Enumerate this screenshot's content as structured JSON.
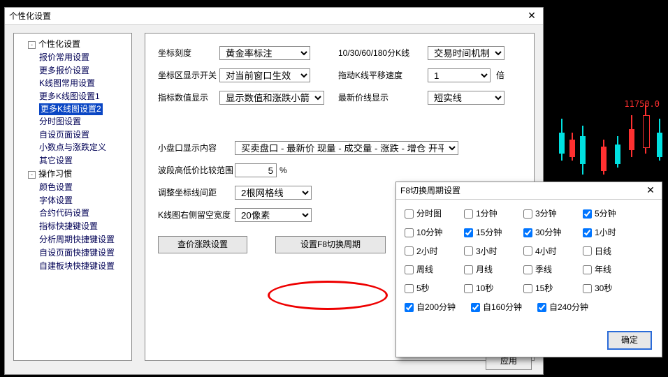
{
  "main": {
    "title": "个性化设置",
    "tree": {
      "root1": "个性化设置",
      "items1": [
        "报价常用设置",
        "更多报价设置",
        "K线图常用设置",
        "更多K线图设置1",
        "更多K线图设置2",
        "分时图设置",
        "自设页面设置",
        "小数点与涨跌定义",
        "其它设置"
      ],
      "selIndex": 4,
      "root2": "操作习惯",
      "items2": [
        "颜色设置",
        "字体设置",
        "合约代码设置",
        "指标快捷键设置",
        "分析周期快捷键设置",
        "自设页面快捷键设置",
        "自建板块快捷键设置"
      ]
    },
    "labels": {
      "zbkd": "坐标刻度",
      "zbqxkkg": "坐标区显示开关",
      "zbszxs": "指标数值显示",
      "r_1030": "10/30/60/180分K线",
      "r_drag": "拖动K线平移速度",
      "r_last": "最新价线显示",
      "bei": "倍",
      "xpkxs": "小盘口显示内容",
      "bdgd": "波段高低价比较范围",
      "tzzb": "调整坐标线间距",
      "kxylk": "K线图右侧留空宽度",
      "pct": "%"
    },
    "values": {
      "zbkd": "黄金率标注",
      "zbqxkkg": "对当前窗口生效",
      "zbszxs": "显示数值和涨跌小箭头",
      "r_1030": "交易时间机制",
      "r_drag": "1",
      "r_last": "短实线",
      "xpkxs": "买卖盘口 - 最新价 现量 - 成交量 - 涨跌 - 增仓 开平",
      "bdgd": "5",
      "tzzb": "2根网格线",
      "kxylk": "20像素"
    },
    "buttons": {
      "cjzd": "查价涨跌设置",
      "szf8": "设置F8切换周期",
      "apply": "应用"
    }
  },
  "pop": {
    "title": "F8切换周期设置",
    "rows": [
      [
        {
          "l": "分时图",
          "c": 0
        },
        {
          "l": "1分钟",
          "c": 0
        },
        {
          "l": "3分钟",
          "c": 0
        },
        {
          "l": "5分钟",
          "c": 1
        }
      ],
      [
        {
          "l": "10分钟",
          "c": 0
        },
        {
          "l": "15分钟",
          "c": 1
        },
        {
          "l": "30分钟",
          "c": 1
        },
        {
          "l": "1小时",
          "c": 1
        }
      ],
      [
        {
          "l": "2小时",
          "c": 0
        },
        {
          "l": "3小时",
          "c": 0
        },
        {
          "l": "4小时",
          "c": 0
        },
        {
          "l": "日线",
          "c": 0
        }
      ],
      [
        {
          "l": "周线",
          "c": 0
        },
        {
          "l": "月线",
          "c": 0
        },
        {
          "l": "季线",
          "c": 0
        },
        {
          "l": "年线",
          "c": 0
        }
      ],
      [
        {
          "l": "5秒",
          "c": 0
        },
        {
          "l": "10秒",
          "c": 0
        },
        {
          "l": "15秒",
          "c": 0
        },
        {
          "l": "30秒",
          "c": 0
        }
      ],
      [
        {
          "l": "自200分钟",
          "c": 1
        },
        {
          "l": "自160分钟",
          "c": 1
        },
        {
          "l": "自240分钟",
          "c": 1
        }
      ]
    ],
    "ok": "确定"
  },
  "chart": {
    "price": "11750.0"
  }
}
